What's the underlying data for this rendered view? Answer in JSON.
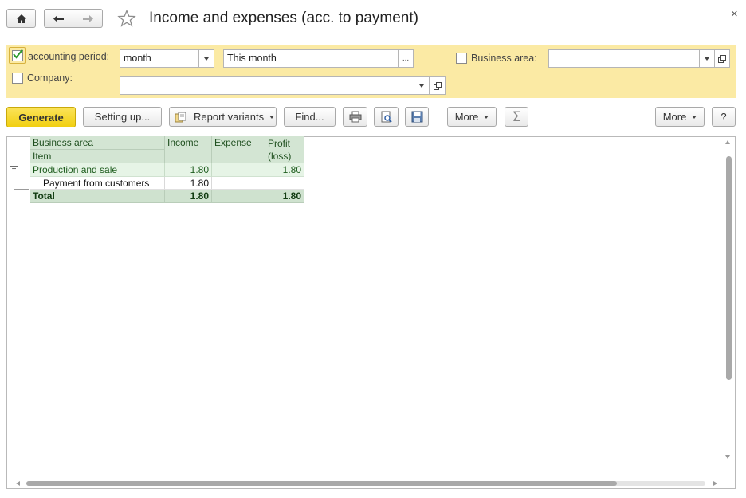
{
  "window": {
    "title": "Income and expenses (acc. to payment)",
    "close_glyph": "×"
  },
  "nav": {
    "home_icon": "home-icon",
    "back_icon": "arrow-left-icon",
    "forward_icon": "arrow-right-icon",
    "favorite_icon": "star-icon"
  },
  "filters": {
    "accounting_period": {
      "label": "accounting period:",
      "checked": true,
      "period_type": "month",
      "period_value": "This month",
      "ellipsis": "..."
    },
    "company": {
      "label": "Company:",
      "checked": false,
      "value": ""
    },
    "business_area": {
      "label": "Business area:",
      "checked": false,
      "value": ""
    },
    "panel_color": "#fbeaa4"
  },
  "toolbar": {
    "generate": "Generate",
    "setting_up": "Setting up...",
    "report_variants": "Report variants",
    "find": "Find...",
    "more_1": "More",
    "more_2": "More",
    "help": "?",
    "print_icon": "printer-icon",
    "preview_icon": "print-preview-icon",
    "save_icon": "save-icon",
    "sum_icon": "sigma-icon",
    "generate_color": "#f5d623"
  },
  "report": {
    "headers": {
      "business_area": "Business area",
      "item": "Item",
      "income": "Income",
      "expense": "Expense",
      "profit_line1": "Profit",
      "profit_line2": "(loss)"
    },
    "rows": [
      {
        "name": "Production and sale",
        "income": "1.80",
        "expense": "",
        "profit": "1.80",
        "level": 0
      },
      {
        "name": "Payment from customers",
        "income": "1.80",
        "expense": "",
        "profit": "",
        "level": 1
      }
    ],
    "total": {
      "name": "Total",
      "income": "1.80",
      "expense": "",
      "profit": "1.80"
    },
    "collapse_glyph": "−"
  }
}
